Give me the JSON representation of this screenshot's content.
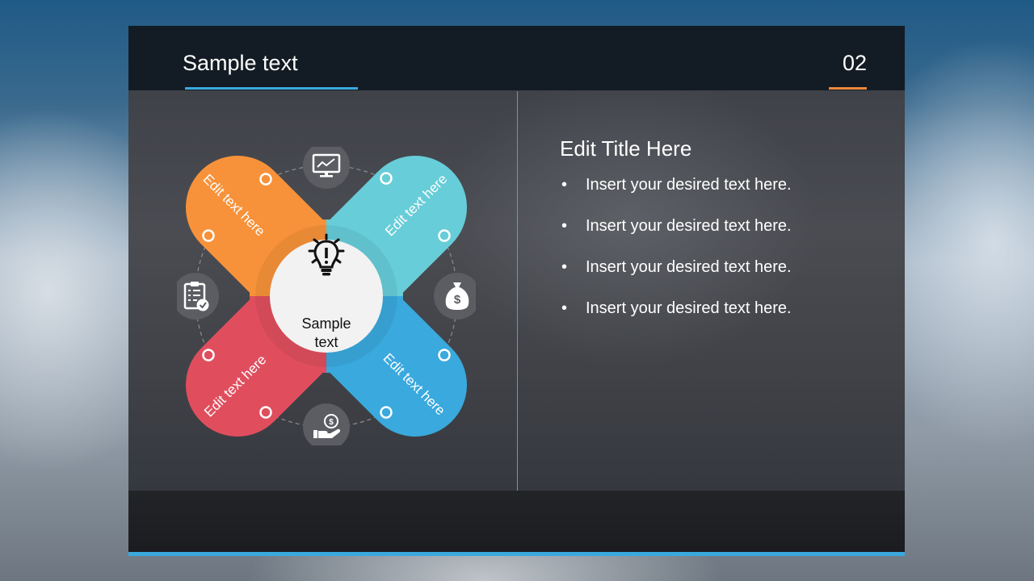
{
  "header": {
    "title": "Sample text",
    "page_number": "02"
  },
  "diagram": {
    "center_label_line1": "Sample",
    "center_label_line2": "text",
    "petals": [
      {
        "label": "Edit text here",
        "color": "#f7923a"
      },
      {
        "label": "Edit text here",
        "color": "#67cdd8"
      },
      {
        "label": "Edit text here",
        "color": "#e04e5e"
      },
      {
        "label": "Edit text here",
        "color": "#3aa9de"
      }
    ],
    "icons": [
      "monitor-chart-icon",
      "clipboard-checklist-icon",
      "money-bag-icon",
      "hand-coin-icon"
    ]
  },
  "content": {
    "title": "Edit Title Here",
    "bullet_symbol": "•",
    "bullets": [
      "Insert your desired text here.",
      "Insert your desired text here.",
      "Insert your desired text here.",
      "Insert your desired text here."
    ]
  },
  "colors": {
    "accent_blue": "#3aa9de",
    "accent_orange": "#f0873b",
    "header_bg": "#131c24"
  }
}
